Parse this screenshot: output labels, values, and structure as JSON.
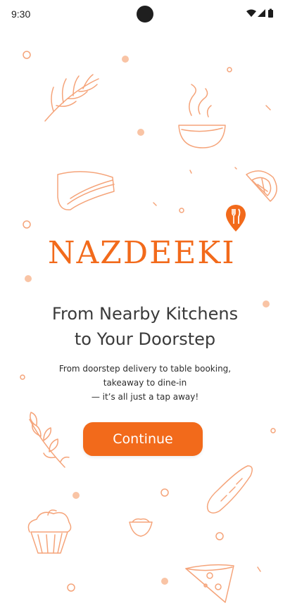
{
  "status_bar": {
    "time": "9:30"
  },
  "brand": {
    "name": "NAZDEEKI",
    "color": "#f26a1b"
  },
  "hero": {
    "headline_line1": "From Nearby Kitchens",
    "headline_line2": "to Your Doorstep",
    "subtext_line1": "From doorstep delivery to table booking,",
    "subtext_line2": "takeaway to dine-in",
    "subtext_line3": "— it’s all just a tap away!"
  },
  "actions": {
    "continue_label": "Continue"
  },
  "theme": {
    "accent": "#f26a1b",
    "doodle": "#f5a47a"
  }
}
